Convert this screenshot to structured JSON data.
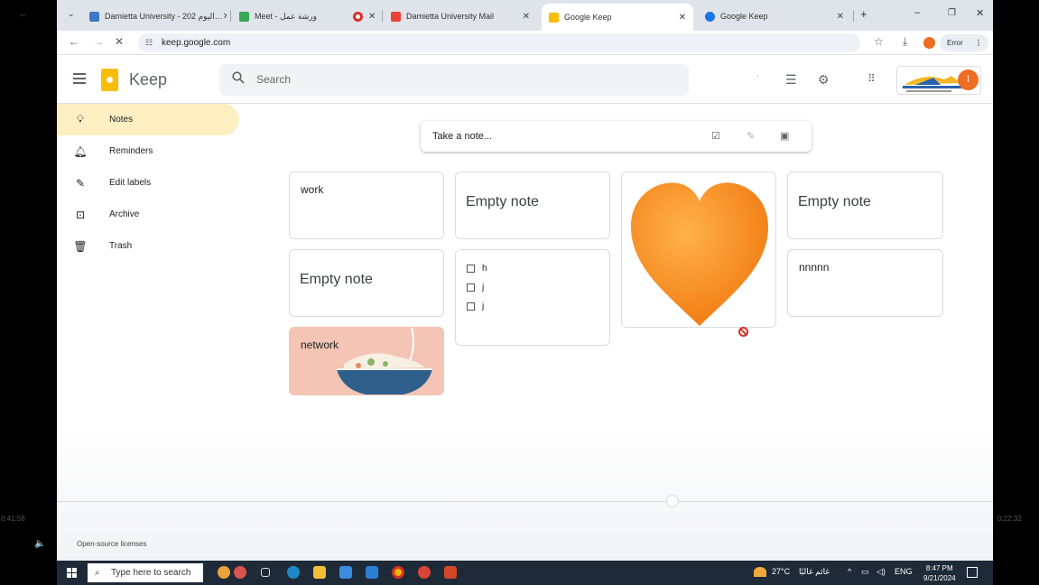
{
  "player": {
    "time_elapsed": "0:41:58",
    "time_remaining": "0:22:32"
  },
  "browser": {
    "tabs": [
      {
        "title": "Damietta University - اليوم 202…",
        "favicon_color": "#3a78c4",
        "active": false
      },
      {
        "title": "Meet - ورشة عمل",
        "favicon_color": "#34a853",
        "active": false
      },
      {
        "title": "",
        "favicon_color": "#d93025",
        "active": false
      },
      {
        "title": "Damietta University Mail",
        "favicon_color": "#ea4335",
        "active": false
      },
      {
        "title": "Google Keep",
        "favicon_color": "#fbbc04",
        "active": true
      },
      {
        "title": "Google Keep",
        "favicon_color": "#1a73e8",
        "active": false
      }
    ],
    "url": "keep.google.com",
    "error_label": "Error"
  },
  "header": {
    "app_name": "Keep",
    "search_placeholder": "Search",
    "avatar_initial": "I"
  },
  "sidebar": {
    "items": [
      {
        "label": "Notes",
        "icon": "lightbulb-icon",
        "active": true
      },
      {
        "label": "Reminders",
        "icon": "bell-icon",
        "active": false
      },
      {
        "label": "Edit labels",
        "icon": "pencil-icon",
        "active": false
      },
      {
        "label": "Archive",
        "icon": "archive-icon",
        "active": false
      },
      {
        "label": "Trash",
        "icon": "trash-icon",
        "active": false
      }
    ]
  },
  "take_note": {
    "placeholder": "Take a note..."
  },
  "notes": {
    "work": {
      "title": "work"
    },
    "empty1": {
      "text": "Empty note"
    },
    "empty2": {
      "text": "Empty note"
    },
    "empty3": {
      "text": "Empty note"
    },
    "nnnnn": {
      "title": "nnnnn"
    },
    "network": {
      "title": "network",
      "bg_color": "#f4c4b4"
    },
    "checklist": {
      "items": [
        "h",
        "j",
        "j"
      ]
    }
  },
  "footer": {
    "open_source": "Open-source licenses"
  },
  "taskbar": {
    "search_placeholder": "Type here to search",
    "weather": "27°C",
    "weather_text": "غائم غالبًا",
    "language": "ENG",
    "time": "8:47 PM",
    "date": "9/21/2024"
  },
  "colors": {
    "active_nav": "#feefc3",
    "keep_yellow": "#fbbc04",
    "heart": "#f48a1c"
  }
}
